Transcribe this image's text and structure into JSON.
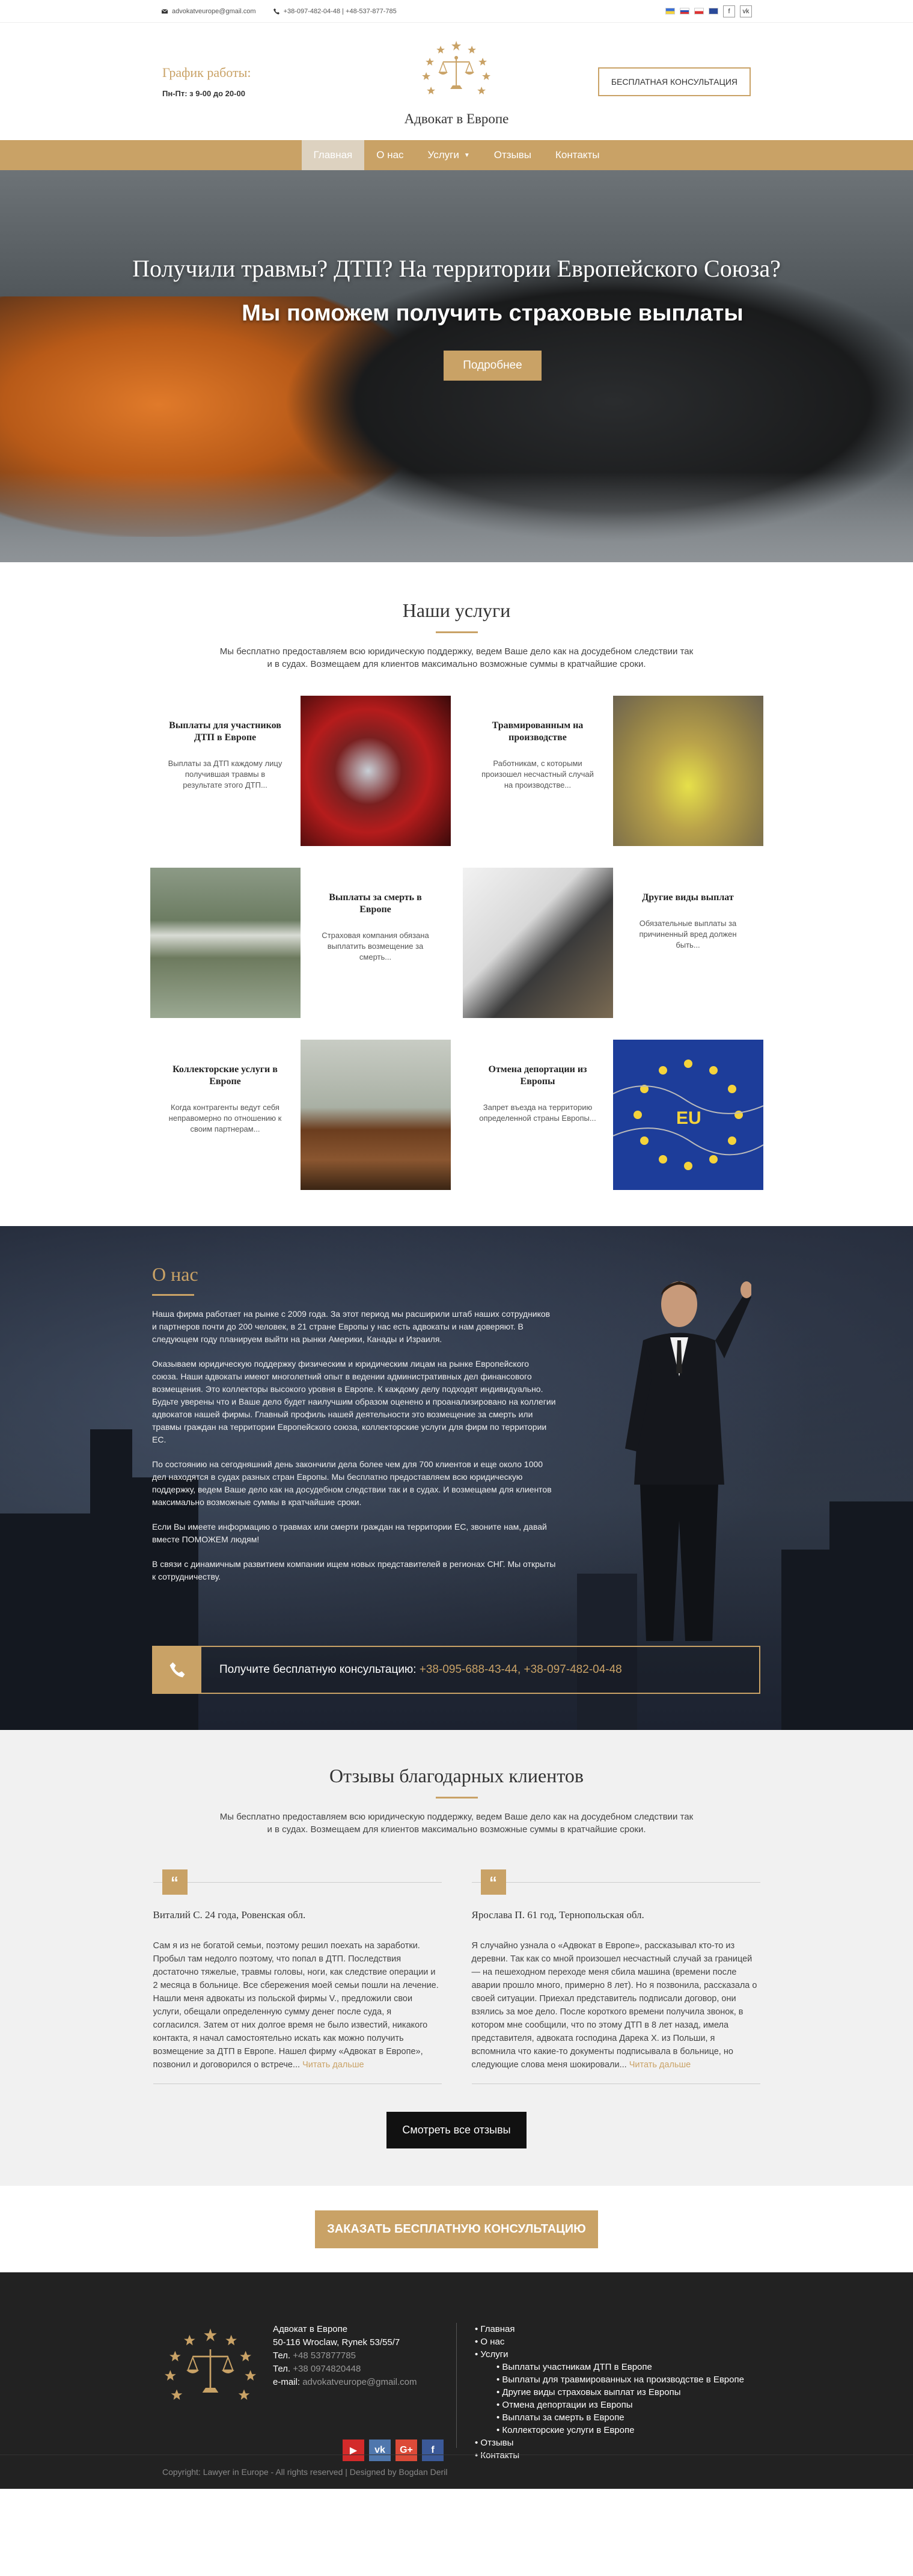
{
  "topbar": {
    "email": "advokatveurope@gmail.com",
    "phones": "+38-097-482-04-48 | +48-537-877-785",
    "flags": [
      "ua",
      "ru",
      "pl",
      "uk"
    ],
    "fb": "f",
    "vk": "vk"
  },
  "header": {
    "hours_title": "График работы:",
    "hours": "Пн-Пт: з 9-00 до 20-00",
    "logo_text": "Адвокат в Европе",
    "consult_button": "БЕСПЛАТНАЯ КОНСУЛЬТАЦИЯ"
  },
  "nav": {
    "items": [
      {
        "label": "Главная"
      },
      {
        "label": "О нас"
      },
      {
        "label": "Услуги"
      },
      {
        "label": "Отзывы"
      },
      {
        "label": "Контакты"
      }
    ]
  },
  "hero": {
    "title": "Получили травмы? ДТП? На территории Европейского Союза?",
    "subtitle": "Мы поможем получить страховые выплаты",
    "button": "Подробнее"
  },
  "services": {
    "title": "Наши услуги",
    "desc": "Мы бесплатно предоставляем всю юридическую поддержку, ведем Ваше дело как на досудебном следствии так и в судах. Возмещаем для клиентов максимально возможные суммы в кратчайшие сроки.",
    "items": [
      {
        "title": "Выплаты для участников ДТП в Европе",
        "text": "Выплаты за ДТП каждому лицу получившая травмы в результате этого ДТП..."
      },
      {
        "title": "Травмированным на производстве",
        "text": "Работникам, с которыми произошел несчастный случай на производстве..."
      },
      {
        "title": "Выплаты за смерть в Европе",
        "text": "Страховая компания обязана выплатить возмещение за смерть..."
      },
      {
        "title": "Другие виды выплат",
        "text": "Обязательные выплаты за причиненный вред должен быть..."
      },
      {
        "title": "Коллекторские услуги в Европе",
        "text": "Когда контрагенты ведут себя неправомерно по отношению к своим партнерам..."
      },
      {
        "title": "Отмена депортации из Европы",
        "text": "Запрет въезда на территорию определенной страны Европы..."
      }
    ]
  },
  "about": {
    "title": "О нас",
    "p1": "Наша фирма работает на рынке с 2009 года. За этот период мы расширили штаб наших сотрудников и партнеров почти до 200 человек, в 21 стране Европы у нас есть адвокаты и нам доверяют. В следующем году планируем выйти на рынки Америки, Канады и Израиля.",
    "p2": "Оказываем юридическую поддержку физическим и юридическим лицам на рынке Европейского союза. Наши адвокаты имеют многолетний опыт в ведении административных дел финансового возмещения. Это коллекторы высокого уровня в Европе. К каждому делу подходят индивидуально. Будьте уверены что и Ваше дело будет наилучшим образом оценено и проанализировано на коллегии адвокатов нашей фирмы. Главный профиль нашей деятельности это возмещение за смерть или травмы граждан на территории Европейского союза, коллекторские услуги для фирм по территории ЕС.",
    "p3": "По состоянию на сегодняшний день закончили дела более чем для 700 клиентов и еще около 1000 дел находятся в судах разных стран Европы. Мы бесплатно предоставляем всю юридическую поддержку, ведем Ваше дело как на досудебном следствии так и в судах. И возмещаем для клиентов максимально возможные суммы в кратчайшие сроки.",
    "p4": "Если Вы имеете информацию о травмах или смерти граждан на территории ЕС, звоните нам, давай вместе ПОМОЖЕМ людям!",
    "p5": "В связи с динамичным развитием компании ищем новых представителей в регионах СНГ. Мы открыты к сотрудничеству.",
    "cta_text": "Получите бесплатную консультацию:",
    "cta_phones": "+38-095-688-43-44, +38-097-482-04-48"
  },
  "reviews": {
    "title": "Отзывы благодарных клиентов",
    "desc": "Мы бесплатно предоставляем всю юридическую поддержку, ведем Ваше дело как на досудебном следствии так и в судах. Возмещаем для клиентов максимально возможные суммы в кратчайшие сроки.",
    "items": [
      {
        "author": "Виталий С. 24 года, Ровенская обл.",
        "text": "Сам я из не богатой семьи, поэтому решил поехать на заработки. Пробыл там недолго поэтому, что попал в ДТП. Последствия достаточно тяжелые, травмы головы, ноги, как следствие операции и 2 месяца в больнице. Все сбережения моей семьи пошли на лечение. Нашли меня адвокаты из польской фирмы V., предложили свои услуги, обещали определенную сумму денег после суда, я согласился. Затем от них долгое время не было известий, никакого контакта, я начал самостоятельно искать как можно получить возмещение за ДТП в Европе. Нашел фирму «Адвокат в Европе», позвонил и договорился о встрече...",
        "more": "Читать дальше"
      },
      {
        "author": "Ярослава П. 61 год, Тернопольская обл.",
        "text": "Я случайно узнала о «Адвокат в Европе», рассказывал кто-то из деревни. Так как со мной произошел несчастный случай за границей — на пешеходном переходе меня сбила машина (времени после аварии прошло много, примерно 8 лет). Но я позвонила, рассказала о своей ситуации. Приехал представитель подписали договор, они взялись за мое дело. После короткого времени получила звонок, в котором мне сообщили, что по этому ДТП в 8 лет назад, имела представителя, адвоката господина Дарека Х. из Польши, я вспомнила что какие-то документы подписывала в больнице, но следующие слова меня шокировали...",
        "more": "Читать дальше"
      }
    ],
    "button": "Смотреть все отзывы"
  },
  "order": {
    "button": "ЗАКАЗАТЬ БЕСПЛАТНУЮ КОНСУЛЬТАЦИЮ"
  },
  "footer": {
    "company": "Адвокат в Европе",
    "address": "50-116 Wroclaw, Rynek 53/55/7",
    "tel1_label": "Тел.",
    "tel1": "+48 537877785",
    "tel2_label": "Тел.",
    "tel2": "+38 0974820448",
    "email_label": "e-mail:",
    "email": "advokatveurope@gmail.com",
    "menu": [
      {
        "label": "Главная",
        "sub": false
      },
      {
        "label": "О нас",
        "sub": false
      },
      {
        "label": "Услуги",
        "sub": false
      },
      {
        "label": "Выплаты участникам ДТП в Европе",
        "sub": true
      },
      {
        "label": "Выплаты для травмированных на производстве в Европе",
        "sub": true
      },
      {
        "label": "Другие виды страховых выплат из Европы",
        "sub": true
      },
      {
        "label": "Отмена депортации из Европы",
        "sub": true
      },
      {
        "label": "Выплаты за смерть в Европе",
        "sub": true
      },
      {
        "label": "Коллекторские услуги в Европе",
        "sub": true
      },
      {
        "label": "Отзывы",
        "sub": false
      },
      {
        "label": "Контакты",
        "sub": false
      }
    ],
    "copyright": "Copyright: Lawyer in Europe - All rights reserved | Designed by Bogdan Deril",
    "social": {
      "yt": "▶",
      "vk": "vk",
      "gp": "G+",
      "fb": "f"
    }
  },
  "colors": {
    "accent": "#c9a266",
    "dark": "#222222"
  }
}
